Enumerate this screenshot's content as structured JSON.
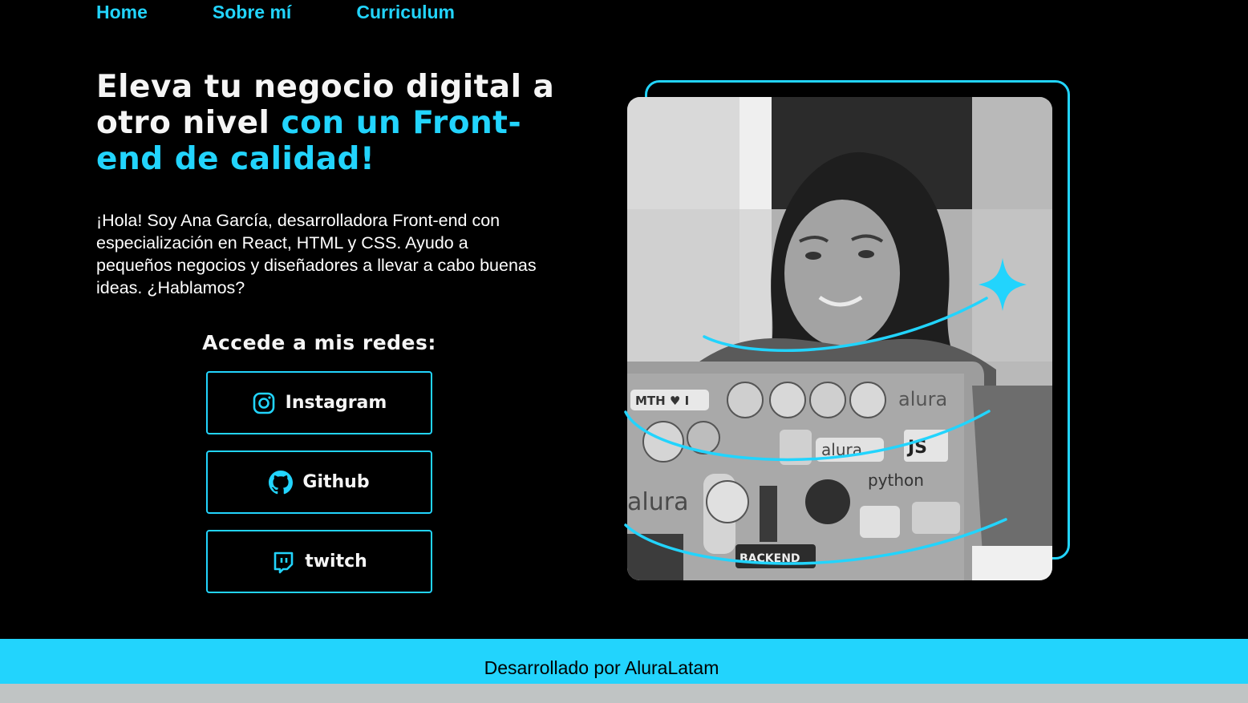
{
  "nav": {
    "items": [
      {
        "label": "Home"
      },
      {
        "label": "Sobre mí"
      },
      {
        "label": "Curriculum"
      }
    ]
  },
  "hero": {
    "title_part1": "Eleva tu negocio digital a otro nivel ",
    "title_accent": "con un Front-end de calidad!",
    "description": "¡Hola! Soy Ana García, desarrolladora Front-end con especialización en React, HTML y CSS. Ayudo a pequeños negocios y diseñadores a llevar a cabo buenas ideas. ¿Hablamos?"
  },
  "social": {
    "heading": "Accede a mis redes:",
    "buttons": [
      {
        "label": "Instagram",
        "icon": "instagram-icon"
      },
      {
        "label": "Github",
        "icon": "github-icon"
      },
      {
        "label": "twitch",
        "icon": "twitch-icon"
      }
    ]
  },
  "photo": {
    "subject": "profile-photo",
    "laptop_stickers": [
      "MTH ♥ I",
      "alura",
      "JS",
      "alura",
      "python",
      "alura",
      "BACKEND"
    ]
  },
  "footer": {
    "text": "Desarrollado por AluraLatam"
  },
  "colors": {
    "accent": "#22d4fd",
    "background": "#000000",
    "text": "#ffffff",
    "strip": "#c0c4c4"
  }
}
